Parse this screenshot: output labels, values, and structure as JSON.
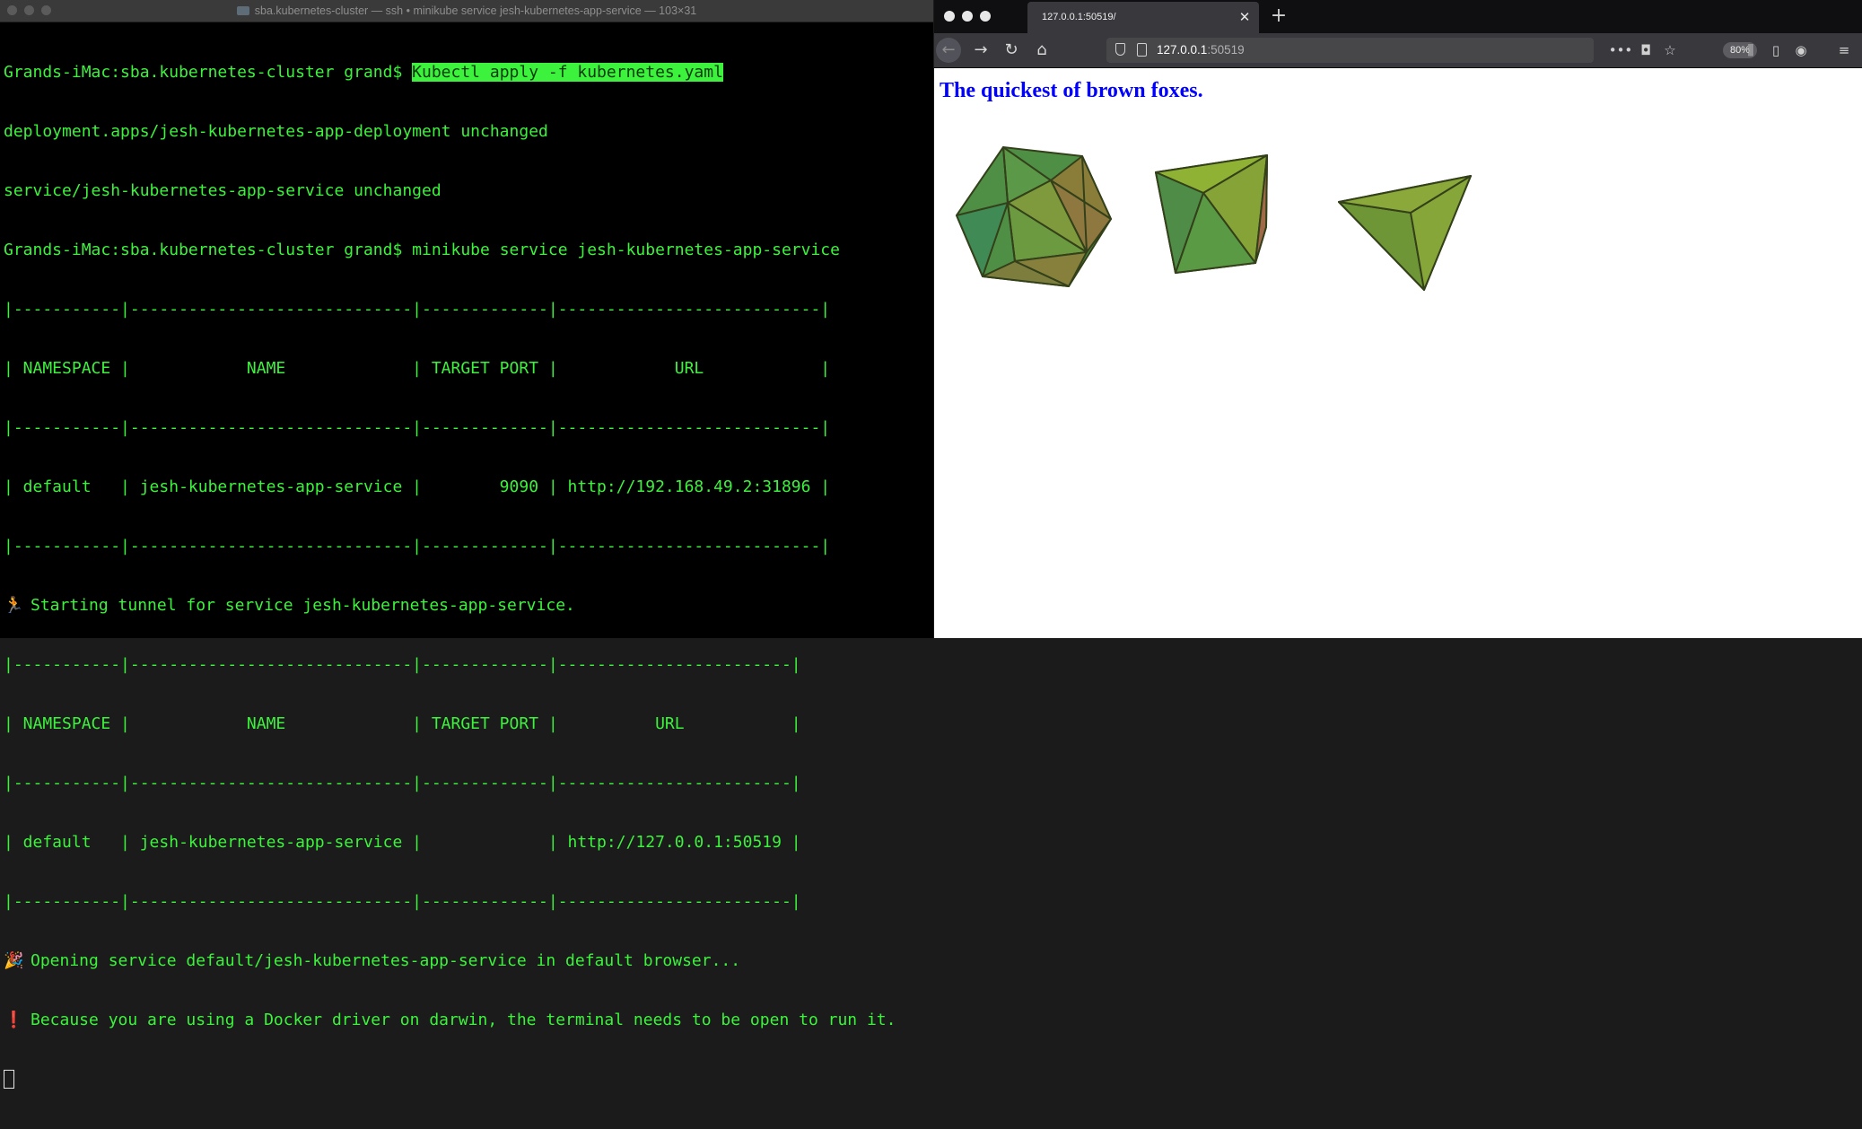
{
  "terminal": {
    "title": "sba.kubernetes-cluster — ssh • minikube service jesh-kubernetes-app-service — 103×31",
    "prompt": "Grands-iMac:sba.kubernetes-cluster grand$ ",
    "cmd1": "Kubectl apply -f kubernetes.yaml",
    "out1": "deployment.apps/jesh-kubernetes-app-deployment unchanged",
    "out2": "service/jesh-kubernetes-app-service unchanged",
    "cmd2": "minikube service jesh-kubernetes-app-service",
    "table1": {
      "border": "|-----------|-----------------------------|-------------|---------------------------|",
      "header": "| NAMESPACE |            NAME             | TARGET PORT |            URL            |",
      "row": "| default   | jesh-kubernetes-app-service |        9090 | http://192.168.49.2:31896 |"
    },
    "tunnel_icon": "🏃",
    "tunnel_msg": "Starting tunnel for service jesh-kubernetes-app-service.",
    "table2": {
      "border": "|-----------|-----------------------------|-------------|------------------------|",
      "header": "| NAMESPACE |            NAME             | TARGET PORT |          URL           |",
      "row": "| default   | jesh-kubernetes-app-service |             | http://127.0.0.1:50519 |"
    },
    "open_icon": "🎉",
    "open_msg": "Opening service default/jesh-kubernetes-app-service in default browser...",
    "warn_icon": "❗",
    "warn_msg": "Because you are using a Docker driver on darwin, the terminal needs to be open to run it."
  },
  "browser": {
    "tab_title": "127.0.0.1:50519/",
    "url_host": "127.0.0.1",
    "url_port": ":50519",
    "zoom": "80%",
    "page_heading": "The quickest of brown foxes.",
    "icons": [
      "back-icon",
      "forward-icon",
      "reload-icon",
      "home-icon",
      "shield-icon",
      "page-icon",
      "more-icon",
      "pocket-icon",
      "bookmark-star-icon",
      "library-icon",
      "sidebar-icon",
      "account-icon",
      "menu-icon"
    ]
  }
}
